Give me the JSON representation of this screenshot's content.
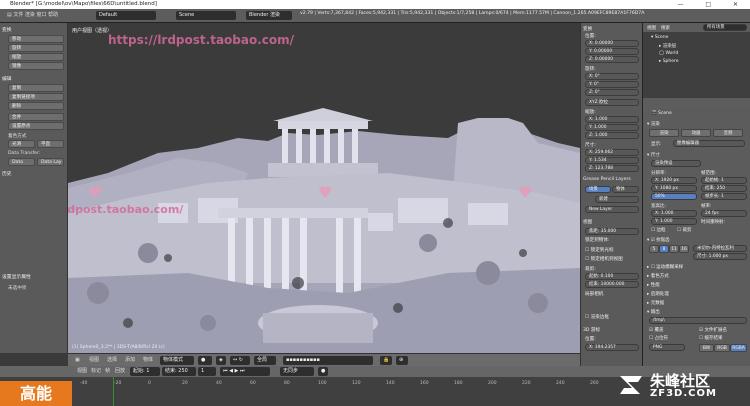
{
  "window": {
    "title": "Blender* [G:\\model\\ov\\Mapo\\files\\66D\\untitled.blend]",
    "controls": [
      "—",
      "□",
      "✕"
    ]
  },
  "header": {
    "layout": "Default",
    "scene": "Scene",
    "engine": "Blender 渲染",
    "stats": "v2.79 | Verts:7,367,842 | Faces:5,942,331 | Tris:5,942,331 | Objects:1/7,258 | Lamps:0/674 | Mem:1177.57M | Cannon_1.265.A09EFC89E87A1F76D7A"
  },
  "toolshelf": {
    "sections": [
      {
        "title": "变换",
        "buttons": [
          "移动",
          "旋转",
          "缩放",
          "镜像"
        ]
      },
      {
        "title": "编辑",
        "buttons": [
          "复制",
          "复制链接项",
          "删除",
          "合并",
          "设置原点"
        ]
      }
    ],
    "shading_label": "着色方式",
    "shading_options": [
      "光滑",
      "平直"
    ],
    "data_transfer_label": "Data Transfer:",
    "data_transfer_options": [
      "Data",
      "Data Lay"
    ],
    "history_label": "历史",
    "display_section": "设置显示属性",
    "display_value": "未选中项"
  },
  "viewport": {
    "label": "用户视图（透视）",
    "footer": "(1) Sphere0_3.2** | 3DS-T/A8/8/Rcl 20 (c)",
    "watermark_top": "https://lrdpost.taobao.com/",
    "watermark_mid": "lrdpost.taobao.com/",
    "header": {
      "view": "视图",
      "select": "选择",
      "add": "添加",
      "object": "物体",
      "mode": "物体模式",
      "global": "全局"
    }
  },
  "npanel": {
    "transform_title": "变换",
    "location": {
      "label": "位置:",
      "x": "0.00000",
      "y": "0.00000",
      "z": "0.00000"
    },
    "rotation": {
      "label": "旋转:",
      "x": "0°",
      "y": "0°",
      "z": "0°"
    },
    "rotation_mode": "XYZ 欧拉",
    "scale": {
      "label": "缩放:",
      "x": "1.000",
      "y": "1.000",
      "z": "1.000"
    },
    "dimensions": {
      "label": "尺寸:",
      "x": "259.062",
      "y": "1.534",
      "z": "123.788"
    },
    "grease_pencil": "Grease Pencil Layers",
    "gp_buttons": [
      "场景",
      "物体"
    ],
    "gp_new": "新建",
    "gp_new_layer": "New Layer",
    "view_title": "视图",
    "lens": {
      "label": "焦距:",
      "value": "35.000"
    },
    "lock_to_object": "锁定到物体:",
    "lock_cursor": "锁定到光标",
    "lock_camera": "锁定相机到视图",
    "clip": {
      "label": "裁剪:",
      "start_label": "起始:",
      "start": "0.100",
      "end_label": "结束:",
      "end": "10000.000"
    },
    "local_camera": "局部相机",
    "render_border": "渲染边框",
    "cursor_title": "3D 游标",
    "cursor_location": "位置:",
    "cursor_x": "194.2357"
  },
  "outliner": {
    "header": [
      "视图",
      "搜索",
      "所有场景"
    ],
    "items": [
      "Scene",
      "渲染层",
      "World",
      "Sphere"
    ]
  },
  "properties": {
    "scene_label": "Scene",
    "render_section": "渲染",
    "render_buttons": [
      "渲染",
      "动画",
      "音频"
    ],
    "display_label": "显示:",
    "display_value": "图像编辑器",
    "dimensions_section": "尺寸",
    "preset_label": "渲染预设",
    "resolution_label": "分辨率:",
    "res_x": "1920 px",
    "res_y": "1080 px",
    "res_pct": "50%",
    "frame_range_label": "帧范围:",
    "start_frame": "起始帧: 1",
    "end_frame": "结束: 250",
    "frame_step": "帧步长: 1",
    "aspect_label": "宽高比:",
    "aspect_x": "1.000",
    "aspect_y": "1.000",
    "fps_label": "帧率:",
    "fps_value": "24 fps",
    "time_remap": "时间重映射:",
    "border_label": "边框",
    "crop_label": "裁剪",
    "antialias_section": "抗锯齿",
    "aa_values": [
      "5",
      "8",
      "11",
      "16"
    ],
    "aa_filter": "米切尔-内特拉瓦利",
    "aa_size": "尺寸: 1.000 px",
    "sampled_motion_blur": "运动模糊采样",
    "shading_section": "着色方式",
    "performance_section": "性能",
    "post_processing_section": "后期处理",
    "metadata_section": "元数据",
    "output_section": "输出",
    "output_path": "/tmp\\",
    "overwrite": "覆盖",
    "file_extensions": "文件扩展名",
    "placeholders": "占位符",
    "cache_result": "缓存结果",
    "format": "PNG",
    "color_modes": [
      "BW",
      "RGB",
      "RGBA"
    ]
  },
  "timeline": {
    "menu": [
      "视图",
      "标记",
      "帧",
      "回放"
    ],
    "start_label": "起始:",
    "start_value": "1",
    "end_label": "结束:",
    "end_value": "250",
    "current": "1",
    "sync": "无同步",
    "ticks": [
      "-40",
      "-20",
      "0",
      "20",
      "40",
      "60",
      "80",
      "100",
      "120",
      "140",
      "160",
      "180",
      "200",
      "220",
      "240",
      "260"
    ]
  },
  "overlay": {
    "badge": "高能",
    "brand_cn": "朱峰社区",
    "brand_en": "ZF3D.COM"
  }
}
